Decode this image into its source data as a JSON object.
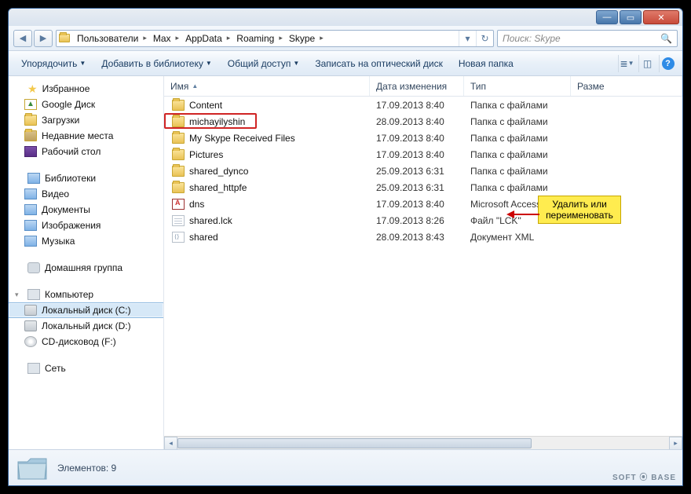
{
  "breadcrumb": [
    "Пользователи",
    "Max",
    "AppData",
    "Roaming",
    "Skype"
  ],
  "search_placeholder": "Поиск: Skype",
  "toolbar": {
    "organize": "Упорядочить",
    "include": "Добавить в библиотеку",
    "share": "Общий доступ",
    "burn": "Записать на оптический диск",
    "newfolder": "Новая папка"
  },
  "sidebar": {
    "favorites": {
      "label": "Избранное",
      "items": [
        "Google Диск",
        "Загрузки",
        "Недавние места",
        "Рабочий стол"
      ]
    },
    "libraries": {
      "label": "Библиотеки",
      "items": [
        "Видео",
        "Документы",
        "Изображения",
        "Музыка"
      ]
    },
    "homegroup": {
      "label": "Домашняя группа"
    },
    "computer": {
      "label": "Компьютер",
      "items": [
        "Локальный диск (C:)",
        "Локальный диск (D:)",
        "CD-дисковод (F:)"
      ]
    },
    "network": {
      "label": "Сеть"
    }
  },
  "columns": {
    "name": "Имя",
    "date": "Дата изменения",
    "type": "Тип",
    "size": "Разме"
  },
  "files": [
    {
      "name": "Content",
      "date": "17.09.2013 8:40",
      "type": "Папка с файлами",
      "icon": "folder"
    },
    {
      "name": "michayilyshin",
      "date": "28.09.2013 8:40",
      "type": "Папка с файлами",
      "icon": "folder",
      "highlighted": true
    },
    {
      "name": "My Skype Received Files",
      "date": "17.09.2013 8:40",
      "type": "Папка с файлами",
      "icon": "folder"
    },
    {
      "name": "Pictures",
      "date": "17.09.2013 8:40",
      "type": "Папка с файлами",
      "icon": "folder"
    },
    {
      "name": "shared_dynco",
      "date": "25.09.2013 6:31",
      "type": "Папка с файлами",
      "icon": "folder"
    },
    {
      "name": "shared_httpfe",
      "date": "25.09.2013 6:31",
      "type": "Папка с файлами",
      "icon": "folder"
    },
    {
      "name": "dns",
      "date": "17.09.2013 8:40",
      "type": "Microsoft Access ...",
      "icon": "dns"
    },
    {
      "name": "shared.lck",
      "date": "17.09.2013 8:26",
      "type": "Файл \"LCK\"",
      "icon": "doc"
    },
    {
      "name": "shared",
      "date": "28.09.2013 8:43",
      "type": "Документ XML",
      "icon": "xml"
    }
  ],
  "annotation": "Удалить или переименовать",
  "status": "Элементов: 9",
  "watermark": "SOFT ⦿ BASE"
}
